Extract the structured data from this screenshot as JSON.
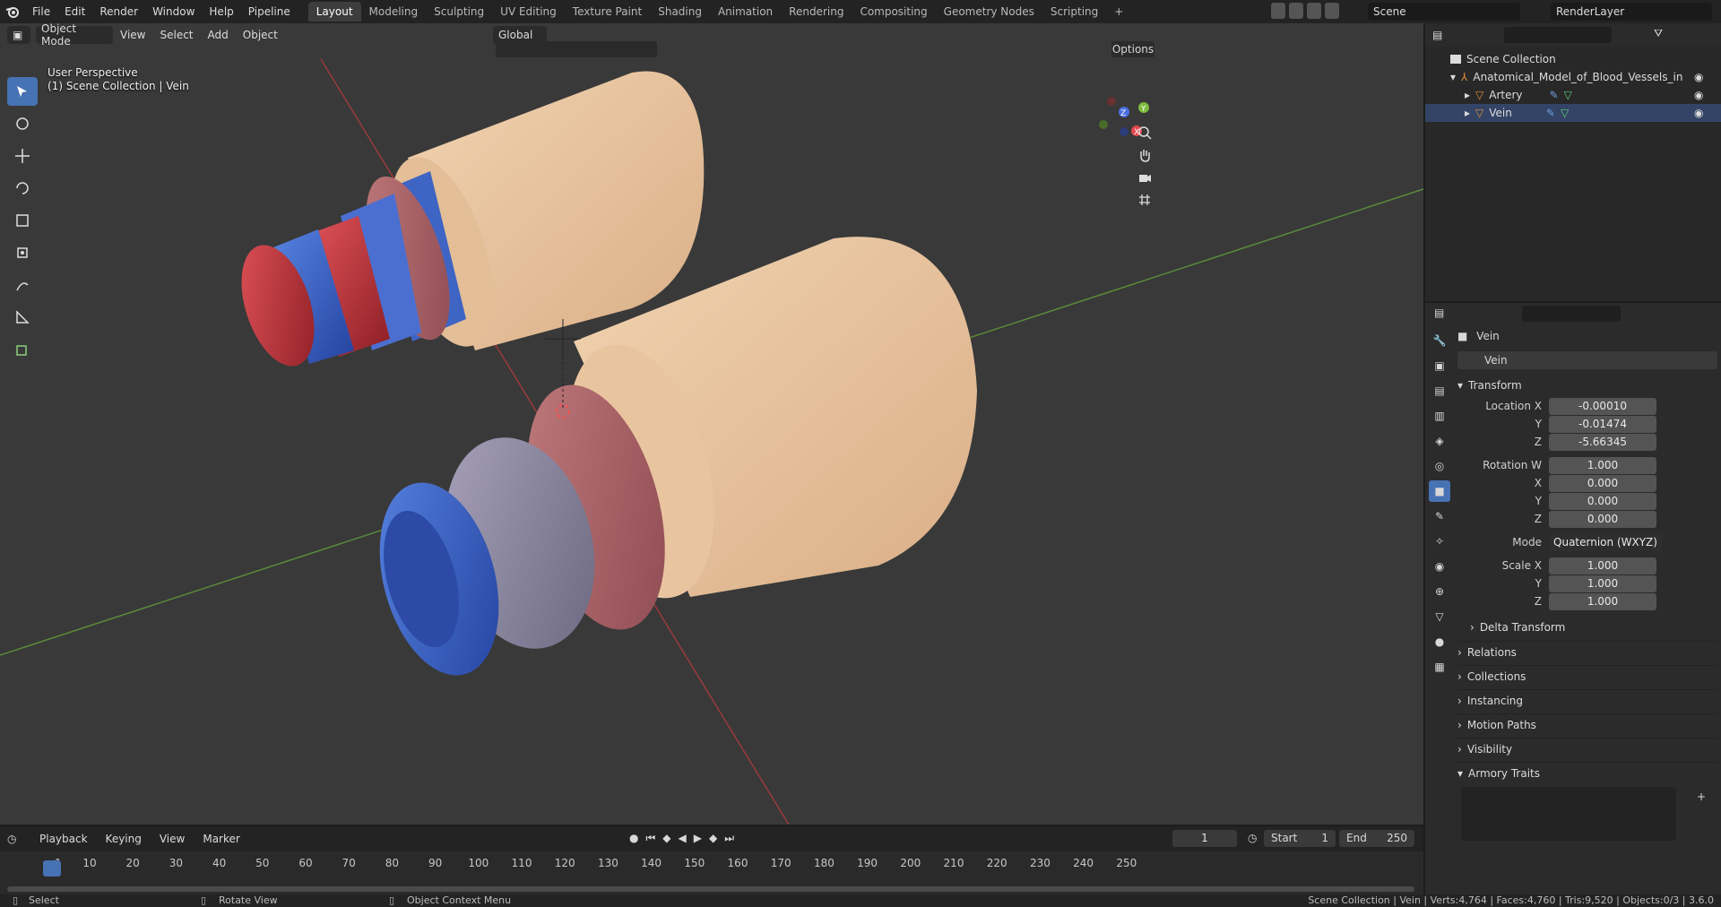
{
  "app": {
    "menus": [
      "File",
      "Edit",
      "Render",
      "Window",
      "Help",
      "Pipeline"
    ],
    "workspaces": [
      "Layout",
      "Modeling",
      "Sculpting",
      "UV Editing",
      "Texture Paint",
      "Shading",
      "Animation",
      "Rendering",
      "Compositing",
      "Geometry Nodes",
      "Scripting"
    ],
    "active_workspace": "Layout",
    "scene": "Scene",
    "view_layer": "RenderLayer"
  },
  "viewport": {
    "mode": "Object Mode",
    "menus": [
      "View",
      "Select",
      "Add",
      "Object"
    ],
    "orientation": "Global",
    "options": "Options",
    "perspective": "User Perspective",
    "context": "(1) Scene Collection | Vein"
  },
  "outliner": {
    "root": "Scene Collection",
    "collection": "Anatomical_Model_of_Blood_Vessels_in",
    "objects": [
      "Artery",
      "Vein"
    ]
  },
  "properties": {
    "object_name": "Vein",
    "datablock": "Vein",
    "transform_label": "Transform",
    "location": {
      "label": "Location X",
      "x": "-0.00010",
      "y": "-0.01474",
      "z": "-5.66345"
    },
    "rotation": {
      "label": "Rotation W",
      "w": "1.000",
      "x": "0.000",
      "y": "0.000",
      "z": "0.000"
    },
    "mode_label": "Mode",
    "mode": "Quaternion (WXYZ)",
    "scale": {
      "label": "Scale X",
      "x": "1.000",
      "y": "1.000",
      "z": "1.000"
    },
    "axis": {
      "x": "X",
      "y": "Y",
      "z": "Z"
    },
    "panels": [
      "Delta Transform",
      "Relations",
      "Collections",
      "Instancing",
      "Motion Paths",
      "Visibility",
      "Armory Traits"
    ]
  },
  "timeline": {
    "menus": [
      "Playback",
      "Keying",
      "View",
      "Marker"
    ],
    "current_frame": "1",
    "start_label": "Start",
    "start": "1",
    "end_label": "End",
    "end": "250",
    "ticks": [
      "1",
      "10",
      "20",
      "30",
      "40",
      "50",
      "60",
      "70",
      "80",
      "90",
      "100",
      "110",
      "120",
      "130",
      "140",
      "150",
      "160",
      "170",
      "180",
      "190",
      "200",
      "210",
      "220",
      "230",
      "240",
      "250"
    ]
  },
  "statusbar": {
    "select": "Select",
    "rotate": "Rotate View",
    "context_menu": "Object Context Menu",
    "stats": "Scene Collection | Vein | Verts:4,764 | Faces:4,760 | Tris:9,520 | Objects:0/3 | 3.6.0"
  },
  "colors": {
    "accent": "#4772b3",
    "adventitia": "#ecc9a3",
    "vein_blue": "#3e64c4",
    "artery_red": "#c0353a",
    "media_pink": "#b46a6e"
  }
}
